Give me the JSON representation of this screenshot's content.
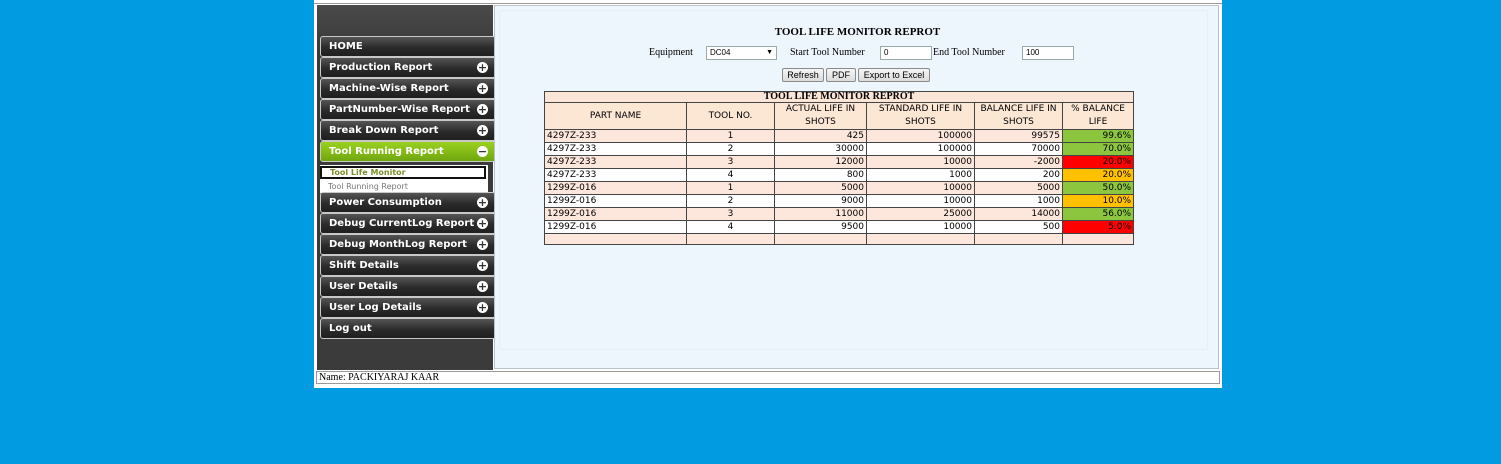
{
  "sidebar": {
    "items": [
      {
        "label": "HOME",
        "icon": "none"
      },
      {
        "label": "Production Report",
        "icon": "plus-icon"
      },
      {
        "label": "Machine-Wise Report",
        "icon": "plus-icon"
      },
      {
        "label": "PartNumber-Wise Report",
        "icon": "plus-icon"
      },
      {
        "label": "Break Down Report",
        "icon": "plus-icon"
      },
      {
        "label": "Tool Running Report",
        "icon": "minus-icon"
      },
      {
        "label": "Power Consumption",
        "icon": "plus-icon"
      },
      {
        "label": "Debug CurrentLog Report",
        "icon": "plus-icon"
      },
      {
        "label": "Debug MonthLog Report",
        "icon": "plus-icon"
      },
      {
        "label": "Shift Details",
        "icon": "plus-icon"
      },
      {
        "label": "User Details",
        "icon": "plus-icon"
      },
      {
        "label": "User Log Details",
        "icon": "plus-icon"
      },
      {
        "label": "Log out",
        "icon": "none"
      }
    ],
    "submenu": [
      {
        "label": "Tool Life Monitor"
      },
      {
        "label": "Tool Running Report"
      }
    ]
  },
  "page": {
    "title": "TOOL LIFE MONITOR REPROT",
    "filters": {
      "equipment_label": "Equipment",
      "equipment_value": "DC04",
      "start_label": "Start Tool Number",
      "start_value": "0",
      "end_label": "End Tool Number",
      "end_value": "100"
    },
    "buttons": {
      "refresh": "Refresh",
      "pdf": "PDF",
      "excel": "Export to Excel"
    }
  },
  "table": {
    "caption": "TOOL LIFE MONITOR REPROT",
    "headers": [
      "PART NAME",
      "TOOL NO.",
      "ACTUAL LIFE IN SHOTS",
      "STANDARD LIFE IN SHOTS",
      "BALANCE LIFE IN SHOTS",
      "%  BALANCE LIFE"
    ],
    "rows": [
      {
        "part": "4297Z-233",
        "tool": "1",
        "actual": "425",
        "standard": "100000",
        "balance": "99575",
        "pct": "99.6%",
        "status": "green"
      },
      {
        "part": "4297Z-233",
        "tool": "2",
        "actual": "30000",
        "standard": "100000",
        "balance": "70000",
        "pct": "70.0%",
        "status": "green"
      },
      {
        "part": "4297Z-233",
        "tool": "3",
        "actual": "12000",
        "standard": "10000",
        "balance": "-2000",
        "pct": "20.0%",
        "status": "red"
      },
      {
        "part": "4297Z-233",
        "tool": "4",
        "actual": "800",
        "standard": "1000",
        "balance": "200",
        "pct": "20.0%",
        "status": "orange"
      },
      {
        "part": "1299Z-016",
        "tool": "1",
        "actual": "5000",
        "standard": "10000",
        "balance": "5000",
        "pct": "50.0%",
        "status": "green"
      },
      {
        "part": "1299Z-016",
        "tool": "2",
        "actual": "9000",
        "standard": "10000",
        "balance": "1000",
        "pct": "10.0%",
        "status": "orange"
      },
      {
        "part": "1299Z-016",
        "tool": "3",
        "actual": "11000",
        "standard": "25000",
        "balance": "14000",
        "pct": "56.0%",
        "status": "green"
      },
      {
        "part": "1299Z-016",
        "tool": "4",
        "actual": "9500",
        "standard": "10000",
        "balance": "500",
        "pct": "5.0%",
        "status": "red"
      }
    ]
  },
  "status_colors": {
    "green": "#8cc63f",
    "orange": "#ffc000",
    "red": "#ff0000"
  },
  "footer": {
    "text": "Name: PACKIYARAJ KAAR"
  }
}
